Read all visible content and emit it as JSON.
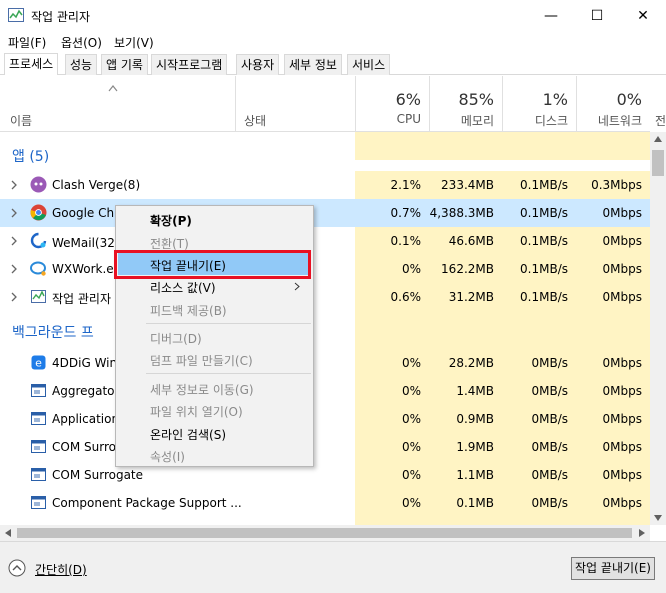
{
  "window": {
    "title": "작업 관리자",
    "min_label": "—",
    "max_label": "☐",
    "close_label": "✕"
  },
  "menu": [
    "파일(F)",
    "옵션(O)",
    "보기(V)"
  ],
  "tabs": [
    "프로세스",
    "성능",
    "앱 기록",
    "시작프로그램",
    "사용자",
    "세부 정보",
    "서비스"
  ],
  "columns": {
    "name": "이름",
    "status": "상태",
    "cpu_pct": "6%",
    "cpu": "CPU",
    "mem_pct": "85%",
    "mem": "메모리",
    "disk_pct": "1%",
    "disk": "디스크",
    "net_pct": "0%",
    "net": "네트워크",
    "extra": "전"
  },
  "groups": {
    "apps": "앱 (5)",
    "background": "백그라운드 프"
  },
  "rows": [
    {
      "name": "Clash Verge(8)",
      "cpu": "2.1%",
      "mem": "233.4MB",
      "disk": "0.1MB/s",
      "net": "0.3Mbps"
    },
    {
      "name": "Google Chr",
      "cpu": "0.7%",
      "mem": "4,388.3MB",
      "disk": "0.1MB/s",
      "net": "0Mbps"
    },
    {
      "name": "WeMail(32비",
      "cpu": "0.1%",
      "mem": "46.6MB",
      "disk": "0.1MB/s",
      "net": "0Mbps"
    },
    {
      "name": "WXWork.exe",
      "cpu": "0%",
      "mem": "162.2MB",
      "disk": "0.1MB/s",
      "net": "0Mbps"
    },
    {
      "name": "작업 관리자",
      "cpu": "0.6%",
      "mem": "31.2MB",
      "disk": "0.1MB/s",
      "net": "0Mbps"
    },
    {
      "name": "4DDiG Win",
      "cpu": "0%",
      "mem": "28.2MB",
      "disk": "0MB/s",
      "net": "0Mbps"
    },
    {
      "name": "Aggregator",
      "cpu": "0%",
      "mem": "1.4MB",
      "disk": "0MB/s",
      "net": "0Mbps"
    },
    {
      "name": "Application",
      "cpu": "0%",
      "mem": "0.9MB",
      "disk": "0MB/s",
      "net": "0Mbps"
    },
    {
      "name": "COM Surro",
      "cpu": "0%",
      "mem": "1.9MB",
      "disk": "0MB/s",
      "net": "0Mbps"
    },
    {
      "name": "COM Surrogate",
      "cpu": "0%",
      "mem": "1.1MB",
      "disk": "0MB/s",
      "net": "0Mbps"
    },
    {
      "name": "Component Package Support ...",
      "cpu": "0%",
      "mem": "0.1MB",
      "disk": "0MB/s",
      "net": "0Mbps"
    }
  ],
  "context_menu": [
    "확장(P)",
    "전환(T)",
    "작업 끝내기(E)",
    "리소스 값(V)",
    "피드백 제공(B)",
    "디버그(D)",
    "덤프 파일 만들기(C)",
    "세부 정보로 이동(G)",
    "파일 위치 열기(O)",
    "온라인 검색(S)",
    "속성(I)"
  ],
  "footer": {
    "fewer": "간단히(D)",
    "end_task": "작업 끝내기(E)"
  },
  "colors": {
    "highlight": "#fff4c4",
    "selected": "#cce8ff",
    "accent": "#1e66c8",
    "red_box": "#e81123"
  }
}
